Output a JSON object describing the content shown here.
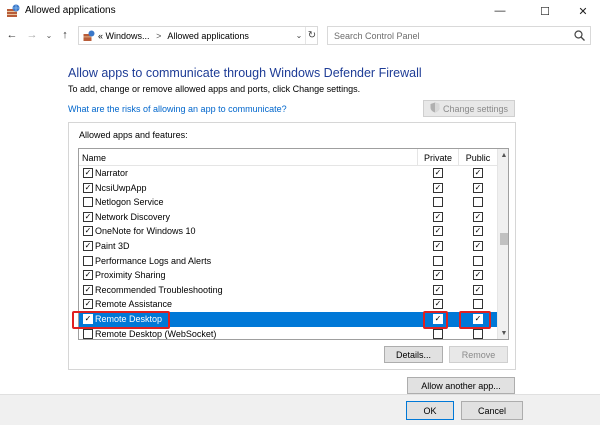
{
  "window": {
    "title": "Allowed applications"
  },
  "window_controls": {
    "minimize": "—",
    "maximize": "☐",
    "close": "✕"
  },
  "address_bar": {
    "crumbs": [
      "«",
      "Windows...",
      ">",
      "Allowed applications"
    ],
    "search_placeholder": "Search Control Panel"
  },
  "content": {
    "heading": "Allow apps to communicate through Windows Defender Firewall",
    "subtext": "To add, change or remove allowed apps and ports, click Change settings.",
    "risk_link": "What are the risks of allowing an app to communicate?",
    "change_settings": "Change settings"
  },
  "list": {
    "group_label": "Allowed apps and features:",
    "columns": {
      "name": "Name",
      "private": "Private",
      "public": "Public"
    },
    "rows": [
      {
        "name": "Narrator",
        "enabled": true,
        "private": true,
        "public": true
      },
      {
        "name": "NcsiUwpApp",
        "enabled": true,
        "private": true,
        "public": true
      },
      {
        "name": "Netlogon Service",
        "enabled": false,
        "private": false,
        "public": false
      },
      {
        "name": "Network Discovery",
        "enabled": true,
        "private": true,
        "public": true
      },
      {
        "name": "OneNote for Windows 10",
        "enabled": true,
        "private": true,
        "public": true
      },
      {
        "name": "Paint 3D",
        "enabled": true,
        "private": true,
        "public": true
      },
      {
        "name": "Performance Logs and Alerts",
        "enabled": false,
        "private": false,
        "public": false
      },
      {
        "name": "Proximity Sharing",
        "enabled": true,
        "private": true,
        "public": true
      },
      {
        "name": "Recommended Troubleshooting",
        "enabled": true,
        "private": true,
        "public": true
      },
      {
        "name": "Remote Assistance",
        "enabled": true,
        "private": true,
        "public": false
      },
      {
        "name": "Remote Desktop",
        "enabled": true,
        "private": true,
        "public": true,
        "selected": true
      },
      {
        "name": "Remote Desktop (WebSocket)",
        "enabled": false,
        "private": false,
        "public": false
      }
    ]
  },
  "buttons": {
    "details": "Details...",
    "remove": "Remove",
    "allow_another": "Allow another app...",
    "ok": "OK",
    "cancel": "Cancel"
  },
  "colors": {
    "heading": "#1e3c96",
    "link": "#0066cc",
    "selection": "#0078d7",
    "highlight": "#e02020"
  }
}
